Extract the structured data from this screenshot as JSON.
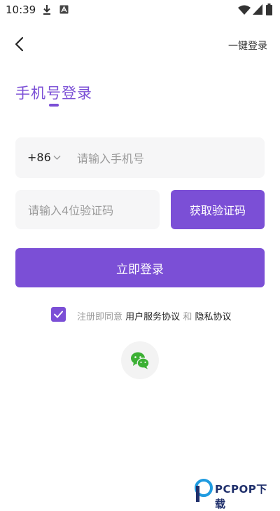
{
  "status_bar": {
    "time": "10:39",
    "icons": [
      "download-icon",
      "app-notification-icon",
      "wifi-icon",
      "signal-icon",
      "battery-icon"
    ]
  },
  "header": {
    "back_icon": "chevron-left-icon",
    "one_key_login": "一键登录"
  },
  "title": "手机号登录",
  "phone": {
    "country_code": "+86",
    "placeholder": "请输入手机号"
  },
  "code": {
    "placeholder": "请输入4位验证码",
    "get_code_label": "获取验证码"
  },
  "login_label": "立即登录",
  "agreement": {
    "checked": true,
    "prefix": "注册即同意",
    "service_link": "用户服务协议",
    "and": "和",
    "privacy_link": "隐私协议"
  },
  "social": {
    "wechat_icon": "wechat-icon"
  },
  "watermark": {
    "text": "PCPOP下载"
  },
  "colors": {
    "accent": "#7b4fd6",
    "field_bg": "#f6f6f7",
    "wechat_green": "#3cb034"
  }
}
